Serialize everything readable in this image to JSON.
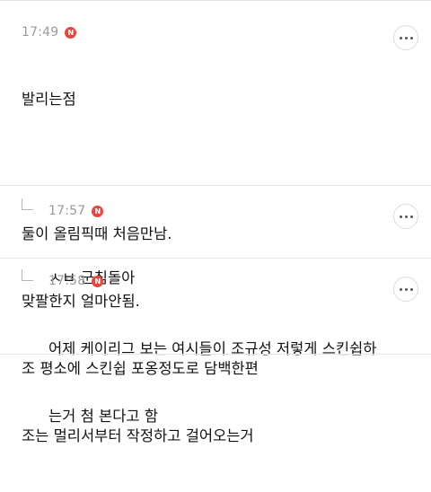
{
  "comments": [
    {
      "time": "17:49",
      "badge": "N",
      "lines": [
        "발리는점",
        "",
        "둘이 올림픽때 처음만남.",
        "맞팔한지 얼마안됨.",
        "조 평소에 스킨쉽 포옹정도로 담백한편",
        "조는 멀리서부터 작정하고 걸어오는거"
      ]
    },
    {
      "time": "17:57",
      "badge": "N",
      "lines": [
        "ㅅㅂ 군침돌아"
      ]
    },
    {
      "time": "17:58",
      "badge": "N",
      "lines": [
        "어제 케이리그 보는 여시들이 조규성 저렇게 스킨쉽하",
        "는거 첨 본다고 함"
      ]
    }
  ],
  "icons": {
    "more": "more-dots-icon",
    "reply": "reply-arrow-icon",
    "badge": "new-badge-icon"
  }
}
